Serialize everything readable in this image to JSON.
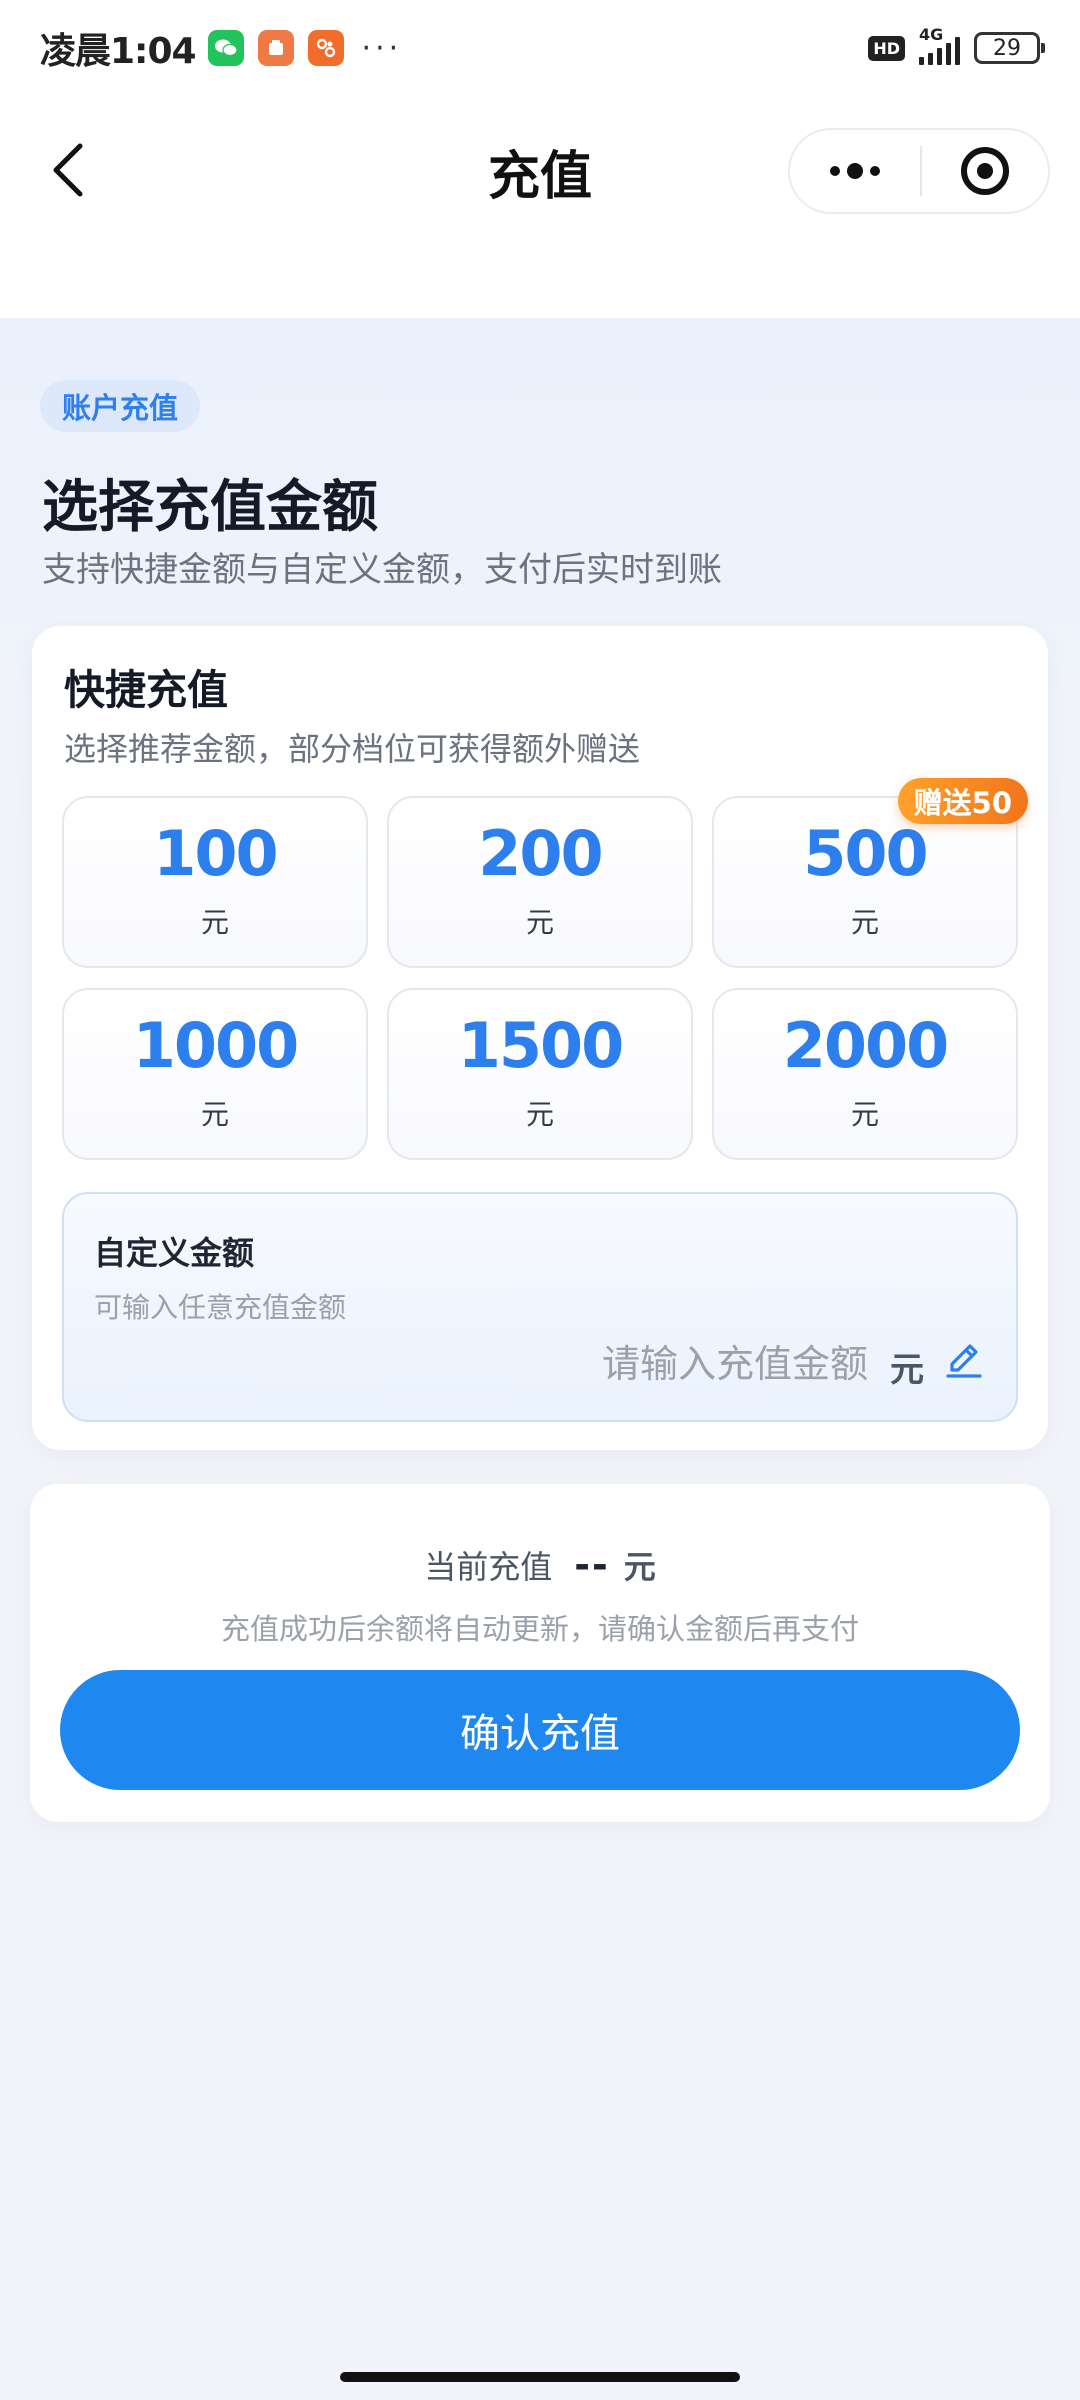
{
  "status_bar": {
    "time": "凌晨1:04",
    "dots": "···",
    "hd": "HD",
    "network": "4G",
    "battery": "29"
  },
  "nav": {
    "title": "充值"
  },
  "hero": {
    "tag": "账户充值",
    "title": "选择充值金额",
    "subtitle": "支持快捷金额与自定义金额，支付后实时到账"
  },
  "quick": {
    "title": "快捷充值",
    "subtitle": "选择推荐金额，部分档位可获得额外赠送",
    "options": [
      {
        "amount": "100",
        "unit": "元"
      },
      {
        "amount": "200",
        "unit": "元"
      },
      {
        "amount": "500",
        "unit": "元",
        "bonus": "赠送50"
      },
      {
        "amount": "1000",
        "unit": "元"
      },
      {
        "amount": "1500",
        "unit": "元"
      },
      {
        "amount": "2000",
        "unit": "元"
      }
    ]
  },
  "custom": {
    "title": "自定义金额",
    "subtitle": "可输入任意充值金额",
    "placeholder": "请输入充值金额",
    "value": "",
    "unit": "元"
  },
  "payment": {
    "current_label": "当前充值",
    "current_value": "--",
    "current_unit": "元",
    "note": "充值成功后余额将自动更新，请确认金额后再支付",
    "confirm_label": "确认充值"
  },
  "colors": {
    "accent": "#1f87f0",
    "amount_text": "#2e7fee",
    "bonus": "#f2751b"
  }
}
